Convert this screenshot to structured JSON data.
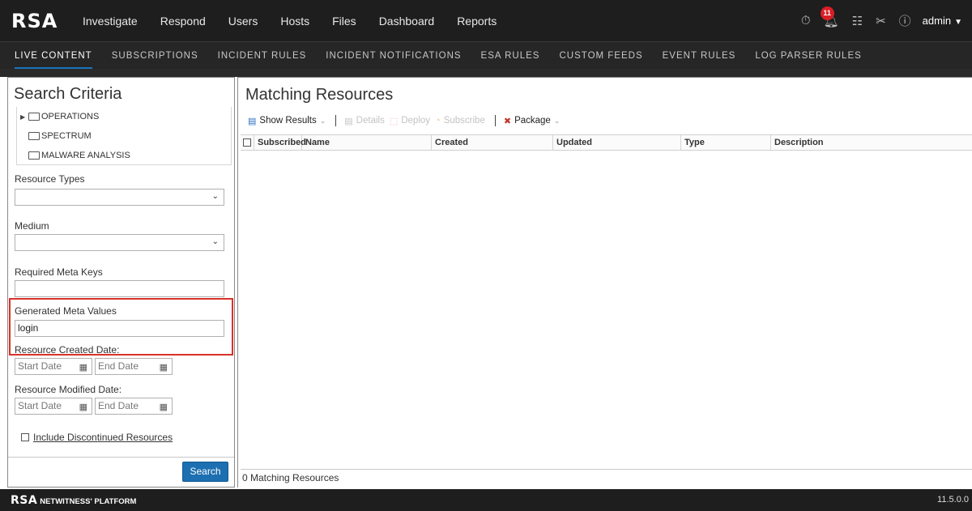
{
  "topbar": {
    "logo": "RSA",
    "nav": [
      "Investigate",
      "Respond",
      "Users",
      "Hosts",
      "Files",
      "Dashboard",
      "Reports"
    ],
    "notification_count": "11",
    "user": "admin"
  },
  "subnav": {
    "items": [
      "LIVE CONTENT",
      "SUBSCRIPTIONS",
      "INCIDENT RULES",
      "INCIDENT NOTIFICATIONS",
      "ESA RULES",
      "CUSTOM FEEDS",
      "EVENT RULES",
      "LOG PARSER RULES"
    ],
    "active": "LIVE CONTENT"
  },
  "search_criteria": {
    "title": "Search Criteria",
    "tree": [
      "OPERATIONS",
      "SPECTRUM",
      "MALWARE ANALYSIS"
    ],
    "resource_types_label": "Resource Types",
    "resource_types_value": "",
    "medium_label": "Medium",
    "medium_value": "",
    "required_meta_keys_label": "Required Meta Keys",
    "required_meta_keys_value": "",
    "generated_meta_values_label": "Generated Meta Values",
    "generated_meta_values_value": "login",
    "created_date_label": "Resource Created Date:",
    "modified_date_label": "Resource Modified Date:",
    "start_date_placeholder": "Start Date",
    "end_date_placeholder": "End Date",
    "include_discontinued_label": "Include Discontinued Resources",
    "search_button": "Search"
  },
  "matching_resources": {
    "title": "Matching Resources",
    "toolbar": {
      "show_results": "Show Results",
      "details": "Details",
      "deploy": "Deploy",
      "subscribe": "Subscribe",
      "package": "Package"
    },
    "columns": [
      "Subscribed",
      "Name",
      "Created",
      "Updated",
      "Type",
      "Description"
    ],
    "rows": [],
    "count_text": "0 Matching Resources"
  },
  "footer": {
    "brand": "RSA",
    "platform": "NETWITNESS' PLATFORM",
    "version": "11.5.0.0"
  },
  "colors": {
    "accent": "#1c6fb0",
    "highlight": "#d9322b",
    "topbar": "#1e1e1e",
    "notification": "#d91e26"
  },
  "icons": [
    "stopwatch-icon",
    "bell-icon",
    "checklist-icon",
    "tools-icon",
    "help-icon"
  ]
}
